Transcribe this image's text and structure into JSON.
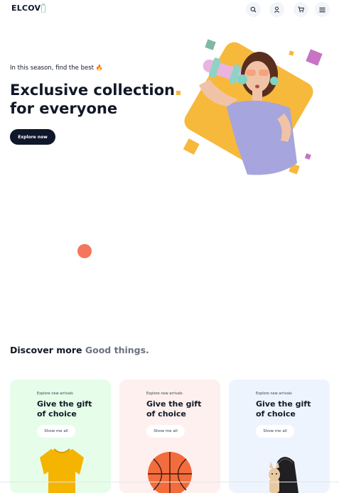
{
  "header": {
    "logo": "ELCOV",
    "icons": [
      "search-icon",
      "user-icon",
      "cart-icon",
      "menu-icon"
    ]
  },
  "hero": {
    "tagline": "In this season, find the best",
    "tagline_emoji": "🔥",
    "headline_line1": "Exclusive collection",
    "headline_line2": "for everyone",
    "cta": "Explore now"
  },
  "discover": {
    "lead": "Discover more",
    "accent": "Good things."
  },
  "cards": [
    {
      "eyebrow": "Explore new arrivals",
      "title_line1": "Give the gift",
      "title_line2": "of choice",
      "button": "Show me all",
      "bg": "#e6fde9",
      "product": "yellow-sweater"
    },
    {
      "eyebrow": "Explore new arrivals",
      "title_line1": "Give the gift",
      "title_line2": "of choice",
      "button": "Show me all",
      "bg": "#fdf0ee",
      "product": "basketball"
    },
    {
      "eyebrow": "Explore new arrivals",
      "title_line1": "Give the gift",
      "title_line2": "of choice",
      "button": "Show me all",
      "bg": "#eef4fd",
      "product": "dog-in-bag"
    }
  ],
  "colors": {
    "accent_yellow": "#f6b93b",
    "dark": "#0f172a",
    "coral": "#f4765c",
    "shape_teal": "#7fb8a3",
    "shape_pink": "#c774c4"
  }
}
